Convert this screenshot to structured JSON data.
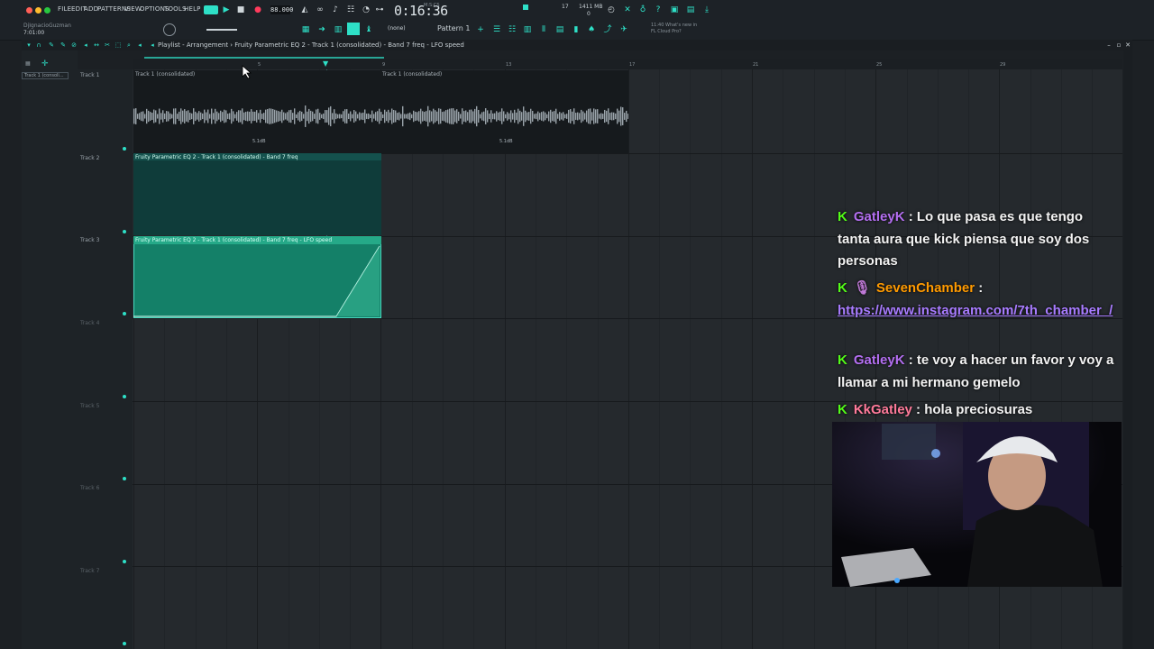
{
  "menu": [
    "FILE",
    "EDIT",
    "ADD",
    "PATTERNS",
    "VIEW",
    "OPTIONS",
    "TOOLS",
    "HELP"
  ],
  "transport": {
    "bpm": "88.000",
    "time": "0:16:36",
    "time_unit": "M:S:CS"
  },
  "user": {
    "name": "DjIgnacioGuzman",
    "time": "7:01:00"
  },
  "cpu": {
    "value": "17",
    "memory": "1411 MB",
    "voices": "0"
  },
  "pattern": {
    "label": "Pattern 1",
    "none": "(none)"
  },
  "news": {
    "line1": "11:40  What's new in",
    "line2": "FL Cloud Pro?"
  },
  "playlist": {
    "title": "Playlist - Arrangement › Fruity Parametric EQ 2 - Track 1 (consolidated) - Band 7 freq - LFO speed"
  },
  "left_panel": {
    "clip_name": "Track 1 (consoli..."
  },
  "ruler": [
    "5",
    "9",
    "13",
    "17",
    "21",
    "25",
    "29"
  ],
  "tracks": [
    {
      "label": "Track 1"
    },
    {
      "label": "Track 2"
    },
    {
      "label": "Track 3"
    },
    {
      "label": "Track 4"
    },
    {
      "label": "Track 5"
    },
    {
      "label": "Track 6"
    },
    {
      "label": "Track 7"
    }
  ],
  "clips": {
    "audio_a": "Track 1 (consolidated)",
    "audio_b": "Track 1 (consolidated)",
    "db_a": "5.1dB",
    "db_b": "5.1dB",
    "auto1": "Fruity Parametric EQ 2 - Track 1 (consolidated) - Band 7 freq",
    "auto2": "Fruity Parametric EQ 2 - Track 1 (consolidated) - Band 7 freq - LFO speed"
  },
  "chat": [
    {
      "user": "GatleyK",
      "sep": " : ",
      "text": "Lo que pasa es que tengo tanta aura que kick piensa que soy dos personas"
    },
    {
      "user": "SevenChamber",
      "sep": " :",
      "link": "https://www.instagram.com/7th_chamber_/"
    },
    {
      "user": "GatleyK",
      "sep": " : ",
      "text": "te voy a hacer un favor y voy a llamar a mi hermano gemelo"
    },
    {
      "user": "KkGatley",
      "sep": " : ",
      "text": "hola preciosuras"
    }
  ],
  "colors": {
    "accent": "#2ee0c7",
    "kick": "#53fc18",
    "automation": "#148068"
  }
}
